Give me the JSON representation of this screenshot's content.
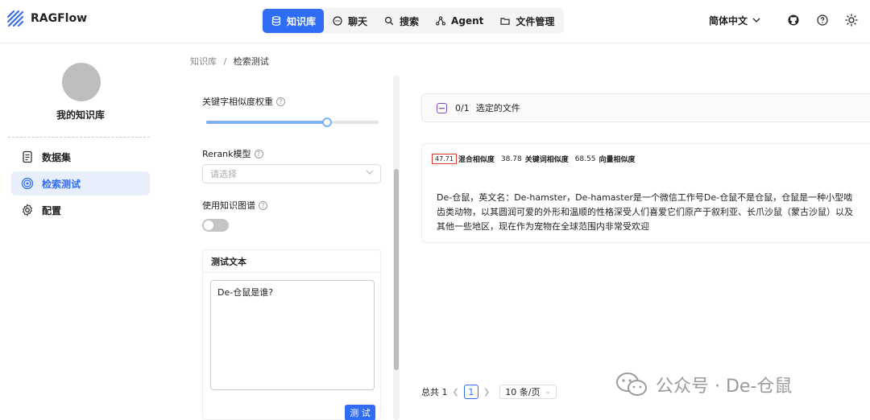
{
  "app": {
    "name": "RAGFlow"
  },
  "nav": {
    "items": [
      {
        "label": "知识库",
        "icon": "database-icon",
        "active": true
      },
      {
        "label": "聊天",
        "icon": "chat-icon",
        "active": false
      },
      {
        "label": "搜索",
        "icon": "search-icon",
        "active": false
      },
      {
        "label": "Agent",
        "icon": "agent-icon",
        "active": false
      },
      {
        "label": "文件管理",
        "icon": "folder-icon",
        "active": false
      }
    ]
  },
  "header": {
    "language": "简体中文"
  },
  "colors": {
    "accent": "#2f6df4",
    "highlight_border": "#e0352b",
    "file_checkbox": "#7c4dcc"
  },
  "sidebar": {
    "kb_name": "我的知识库",
    "items": [
      {
        "label": "数据集",
        "icon": "document-icon",
        "active": false
      },
      {
        "label": "检索测试",
        "icon": "target-icon",
        "active": true
      },
      {
        "label": "配置",
        "icon": "gear-icon",
        "active": false
      }
    ]
  },
  "breadcrumb": {
    "root": "知识库",
    "sep": "/",
    "current": "检索测试"
  },
  "settings": {
    "keyword_weight_label": "关键字相似度权重",
    "keyword_weight_value": 0.7,
    "rerank_label": "Rerank模型",
    "rerank_placeholder": "请选择",
    "kg_label": "使用知识图谱",
    "kg_enabled": false
  },
  "test": {
    "title": "测试文本",
    "query": "De-仓鼠是谁?",
    "button": "测 试"
  },
  "results": {
    "selected_count": "0/1",
    "selected_label": "选定的文件",
    "items": [
      {
        "hybrid_score": "47.71",
        "hybrid_label": "混合相似度",
        "keyword_score": "38.78",
        "keyword_label": "关键词相似度",
        "vector_score": "68.55",
        "vector_label": "向量相似度",
        "text": "De-仓鼠，英文名：De-hamster，De-hamaster是一个微信工作号De-仓鼠不是仓鼠，仓鼠是一种小型啮齿类动物，以其圆润可爱的外形和温顺的性格深受人们喜爱它们原产于叙利亚、长爪沙鼠（蒙古沙鼠）以及其他一些地区，现在作为宠物在全球范围内非常受欢迎"
      }
    ]
  },
  "pagination": {
    "total_label": "总共 1",
    "current_page": "1",
    "page_size": "10 条/页"
  },
  "watermark": {
    "text": "公众号 · De-仓鼠"
  }
}
